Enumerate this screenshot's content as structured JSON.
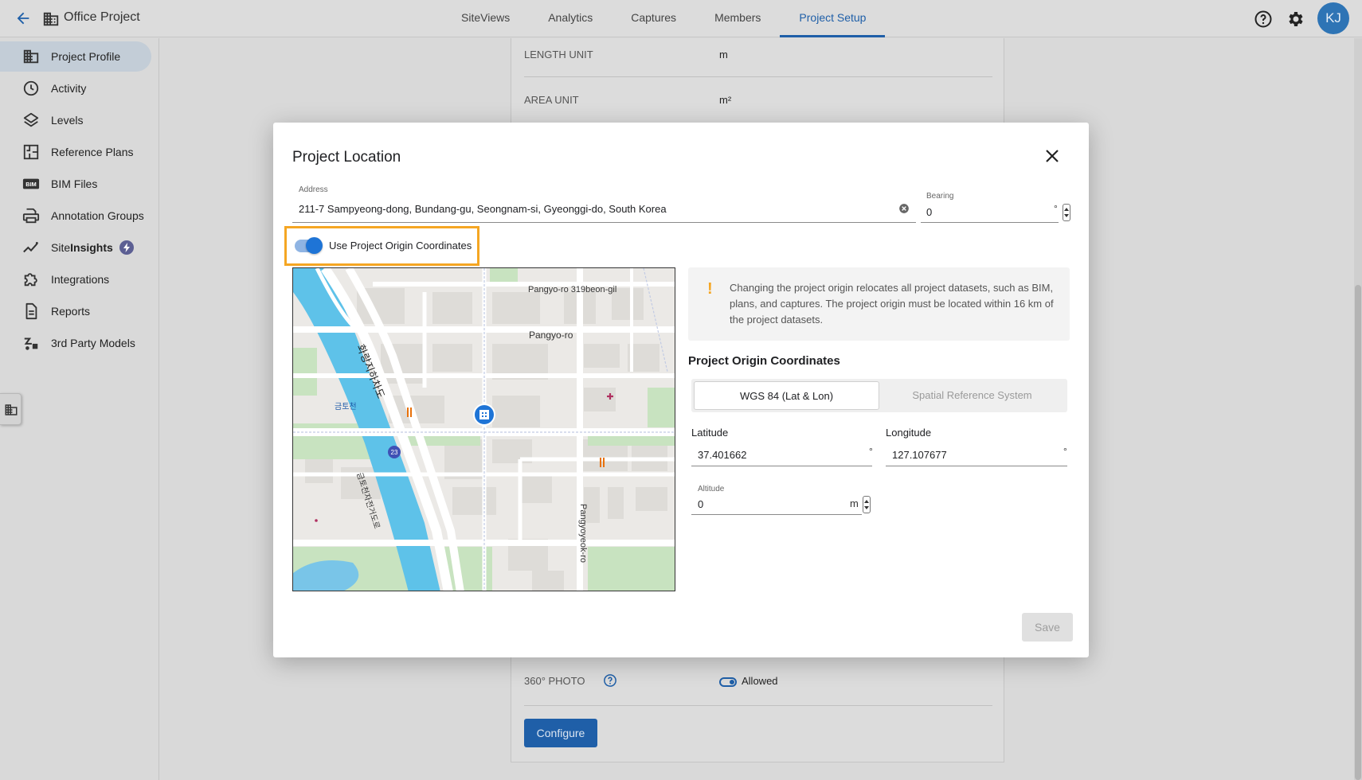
{
  "header": {
    "project_name": "Office Project",
    "tabs": [
      {
        "label": "SiteViews",
        "active": false
      },
      {
        "label": "Analytics",
        "active": false
      },
      {
        "label": "Captures",
        "active": false
      },
      {
        "label": "Members",
        "active": false
      },
      {
        "label": "Project Setup",
        "active": true
      }
    ],
    "avatar_initials": "KJ"
  },
  "sidebar": {
    "items": [
      {
        "label": "Project Profile",
        "icon": "building-icon",
        "active": true
      },
      {
        "label": "Activity",
        "icon": "clock-icon"
      },
      {
        "label": "Levels",
        "icon": "layers-icon"
      },
      {
        "label": "Reference Plans",
        "icon": "floorplan-icon"
      },
      {
        "label": "BIM Files",
        "icon": "bim-icon"
      },
      {
        "label": "Annotation Groups",
        "icon": "printer-icon"
      },
      {
        "label_prefix": "Site",
        "label_bold": "Insights",
        "icon": "trend-icon"
      },
      {
        "label": "Integrations",
        "icon": "puzzle-icon"
      },
      {
        "label": "Reports",
        "icon": "document-icon"
      },
      {
        "label": "3rd Party Models",
        "icon": "models-icon"
      }
    ]
  },
  "background_settings": {
    "length_unit_label": "LENGTH UNIT",
    "length_unit_value": "m",
    "area_unit_label": "AREA UNIT",
    "area_unit_value": "m²",
    "photo_label": "360° PHOTO",
    "photo_value": "Allowed",
    "configure_label": "Configure"
  },
  "modal": {
    "title": "Project Location",
    "address_label": "Address",
    "address_value": "211-7 Sampyeong-dong, Bundang-gu, Seongnam-si, Gyeonggi-do, South Korea",
    "bearing_label": "Bearing",
    "bearing_value": "0",
    "bearing_unit": "°",
    "toggle_label": "Use Project Origin Coordinates",
    "toggle_on": true,
    "notice_icon": "!",
    "notice_text": "Changing the project origin relocates all project datasets, such as BIM, plans, and captures. The project origin must be located within 16 km of the project datasets.",
    "origin_title": "Project Origin Coordinates",
    "segment_options": [
      "WGS 84 (Lat & Lon)",
      "Spatial Reference System"
    ],
    "latitude_label": "Latitude",
    "latitude_value": "37.401662",
    "longitude_label": "Longitude",
    "longitude_value": "127.107677",
    "coord_unit": "°",
    "altitude_label": "Altitude",
    "altitude_value": "0",
    "altitude_unit": "m",
    "save_label": "Save"
  },
  "map": {
    "street_labels": [
      "Pangyo-ro 319beon-gil",
      "Pangyo-ro",
      "Pangyoyeok-ro",
      "화랑지하차도",
      "금토천",
      "금토천자전거도로",
      "23"
    ]
  },
  "colors": {
    "accent": "#1f5fa8",
    "highlight": "#f5a623",
    "toggle": "#1e74d6"
  }
}
